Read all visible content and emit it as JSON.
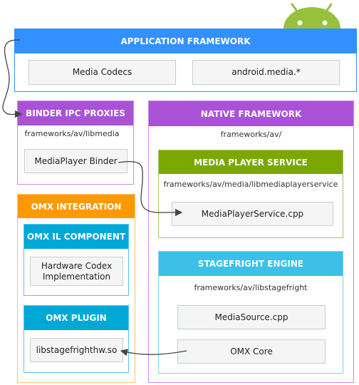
{
  "colors": {
    "app": "#3390ff",
    "purple": "#a952d6",
    "green": "#7aa800",
    "orange": "#ff9900",
    "cyan": "#00a8d6",
    "lightcyan": "#3cc0e8",
    "android": "#97c03d"
  },
  "app_framework": {
    "title": "APPLICATION FRAMEWORK",
    "items": [
      "Media Codecs",
      "android.media.*"
    ]
  },
  "binder": {
    "title": "BINDER IPC PROXIES",
    "path": "frameworks/av/libmedia",
    "item": "MediaPlayer Binder"
  },
  "native": {
    "title": "NATIVE FRAMEWORK",
    "path": "frameworks/av/"
  },
  "mps": {
    "title": "MEDIA PLAYER SERVICE",
    "path": "frameworks/av/media/libmediaplayerservice",
    "item": "MediaPlayerService.cpp"
  },
  "stagefright": {
    "title": "STAGEFRIGHT ENGINE",
    "path": "frameworks/av/libstagefright",
    "items": [
      "MediaSource.cpp",
      "OMX Core"
    ]
  },
  "omx": {
    "title": "OMX INTEGRATION"
  },
  "omx_il": {
    "title": "OMX IL COMPONENT",
    "item_line1": "Hardware Codex",
    "item_line2": "Implementation"
  },
  "omx_plugin": {
    "title": "OMX PLUGIN",
    "item": "libstagefrighthw.so"
  }
}
